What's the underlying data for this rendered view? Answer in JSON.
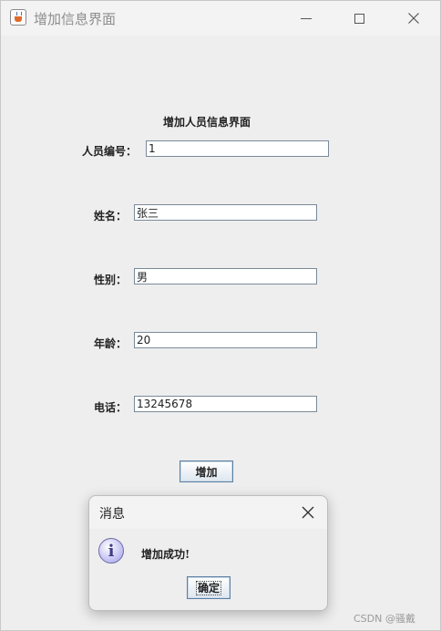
{
  "window": {
    "title": "增加信息界面",
    "icon": "java-cup-icon"
  },
  "form": {
    "heading": "增加人员信息界面",
    "fields": [
      {
        "label": "人员编号：",
        "value": "1"
      },
      {
        "label": "姓名：",
        "value": "张三"
      },
      {
        "label": "性别：",
        "value": "男"
      },
      {
        "label": "年龄：",
        "value": "20"
      },
      {
        "label": "电话：",
        "value": "13245678"
      }
    ],
    "submit_label": "增加"
  },
  "dialog": {
    "title": "消息",
    "icon": "info-icon",
    "icon_glyph": "i",
    "message": "增加成功!",
    "ok_label": "确定"
  },
  "watermark": "CSDN @骚戴"
}
